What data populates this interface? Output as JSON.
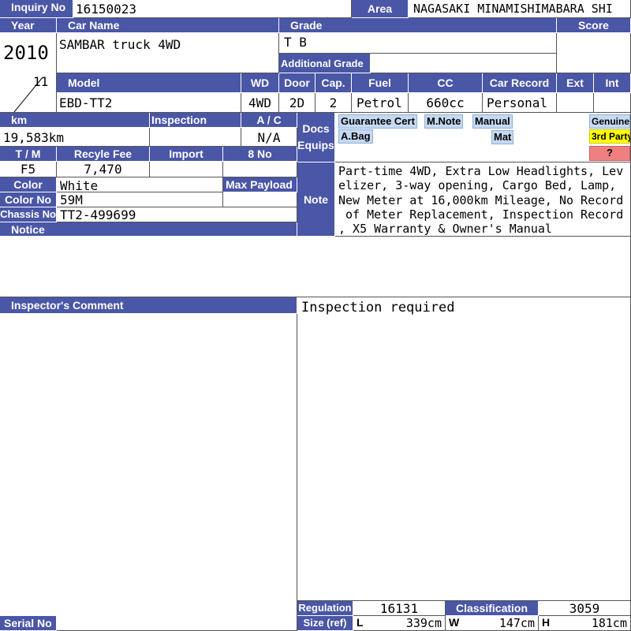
{
  "labels": {
    "inquiry_no": "Inquiry No",
    "area": "Area",
    "year": "Year",
    "car_name": "Car Name",
    "grade": "Grade",
    "score": "Score",
    "additional_grade": "Additional Grade",
    "model": "Model",
    "wd": "WD",
    "door": "Door",
    "cap": "Cap.",
    "fuel": "Fuel",
    "cc": "CC",
    "car_record": "Car Record",
    "ext": "Ext",
    "int": "Int",
    "km": "km",
    "inspection": "Inspection",
    "ac": "A / C",
    "docs": "Docs",
    "equips": "Equips",
    "tm": "T / M",
    "recycle_fee": "Recyle Fee",
    "import": "Import",
    "eight_no": "8 No",
    "color": "Color",
    "max_payload": "Max Payload",
    "note": "Note",
    "color_no": "Color No",
    "chassis_no": "Chassis No",
    "notice": "Notice",
    "inspectors_comment": "Inspector's Comment",
    "regulation": "Regulation",
    "classification": "Classification",
    "size_ref": "Size (ref)",
    "serial_no": "Serial No",
    "L": "L",
    "W": "W",
    "H": "H"
  },
  "values": {
    "inquiry_no": "16150023",
    "area": "NAGASAKI MINAMISHIMABARA SHI",
    "year": "2010",
    "month": "11",
    "car_name": "SAMBAR truck 4WD",
    "grade": "T B",
    "model": "EBD-TT2",
    "wd": "4WD",
    "door": "2D",
    "cap": "2",
    "fuel": "Petrol",
    "cc": "660cc",
    "car_record": "Personal",
    "km": "19,583km",
    "ac": "N/A",
    "tm": "F5",
    "recycle_fee": "7,470",
    "color": "White",
    "color_no": "59M",
    "chassis_no": "TT2-499699",
    "note_lines": [
      "Part-time 4WD, Extra Low Headlights, Lev",
      "elizer, 3-way opening, Cargo Bed, Lamp,",
      "New Meter at 16,000km Mileage, No Record",
      " of Meter Replacement, Inspection Record",
      ", X5 Warranty & Owner's Manual"
    ],
    "inspector_comment": "Inspection required",
    "regulation": "16131",
    "classification": "3059",
    "size_l": "339cm",
    "size_w": "147cm",
    "size_h": "181cm"
  },
  "docs_tags": {
    "guarantee_cert": "Guarantee Cert",
    "m_note": "M.Note",
    "manual": "Manual",
    "a_bag": "A.Bag",
    "mat": "Mat"
  },
  "side_tags": {
    "genuine": "Genuine",
    "third_party": "3rd Party",
    "unknown": "?"
  },
  "colors": {
    "header_bg": "#4a56a6",
    "tag_bg": "#c5d9f1",
    "third_party_bg": "#ffff00",
    "unknown_bg": "#f08080"
  }
}
